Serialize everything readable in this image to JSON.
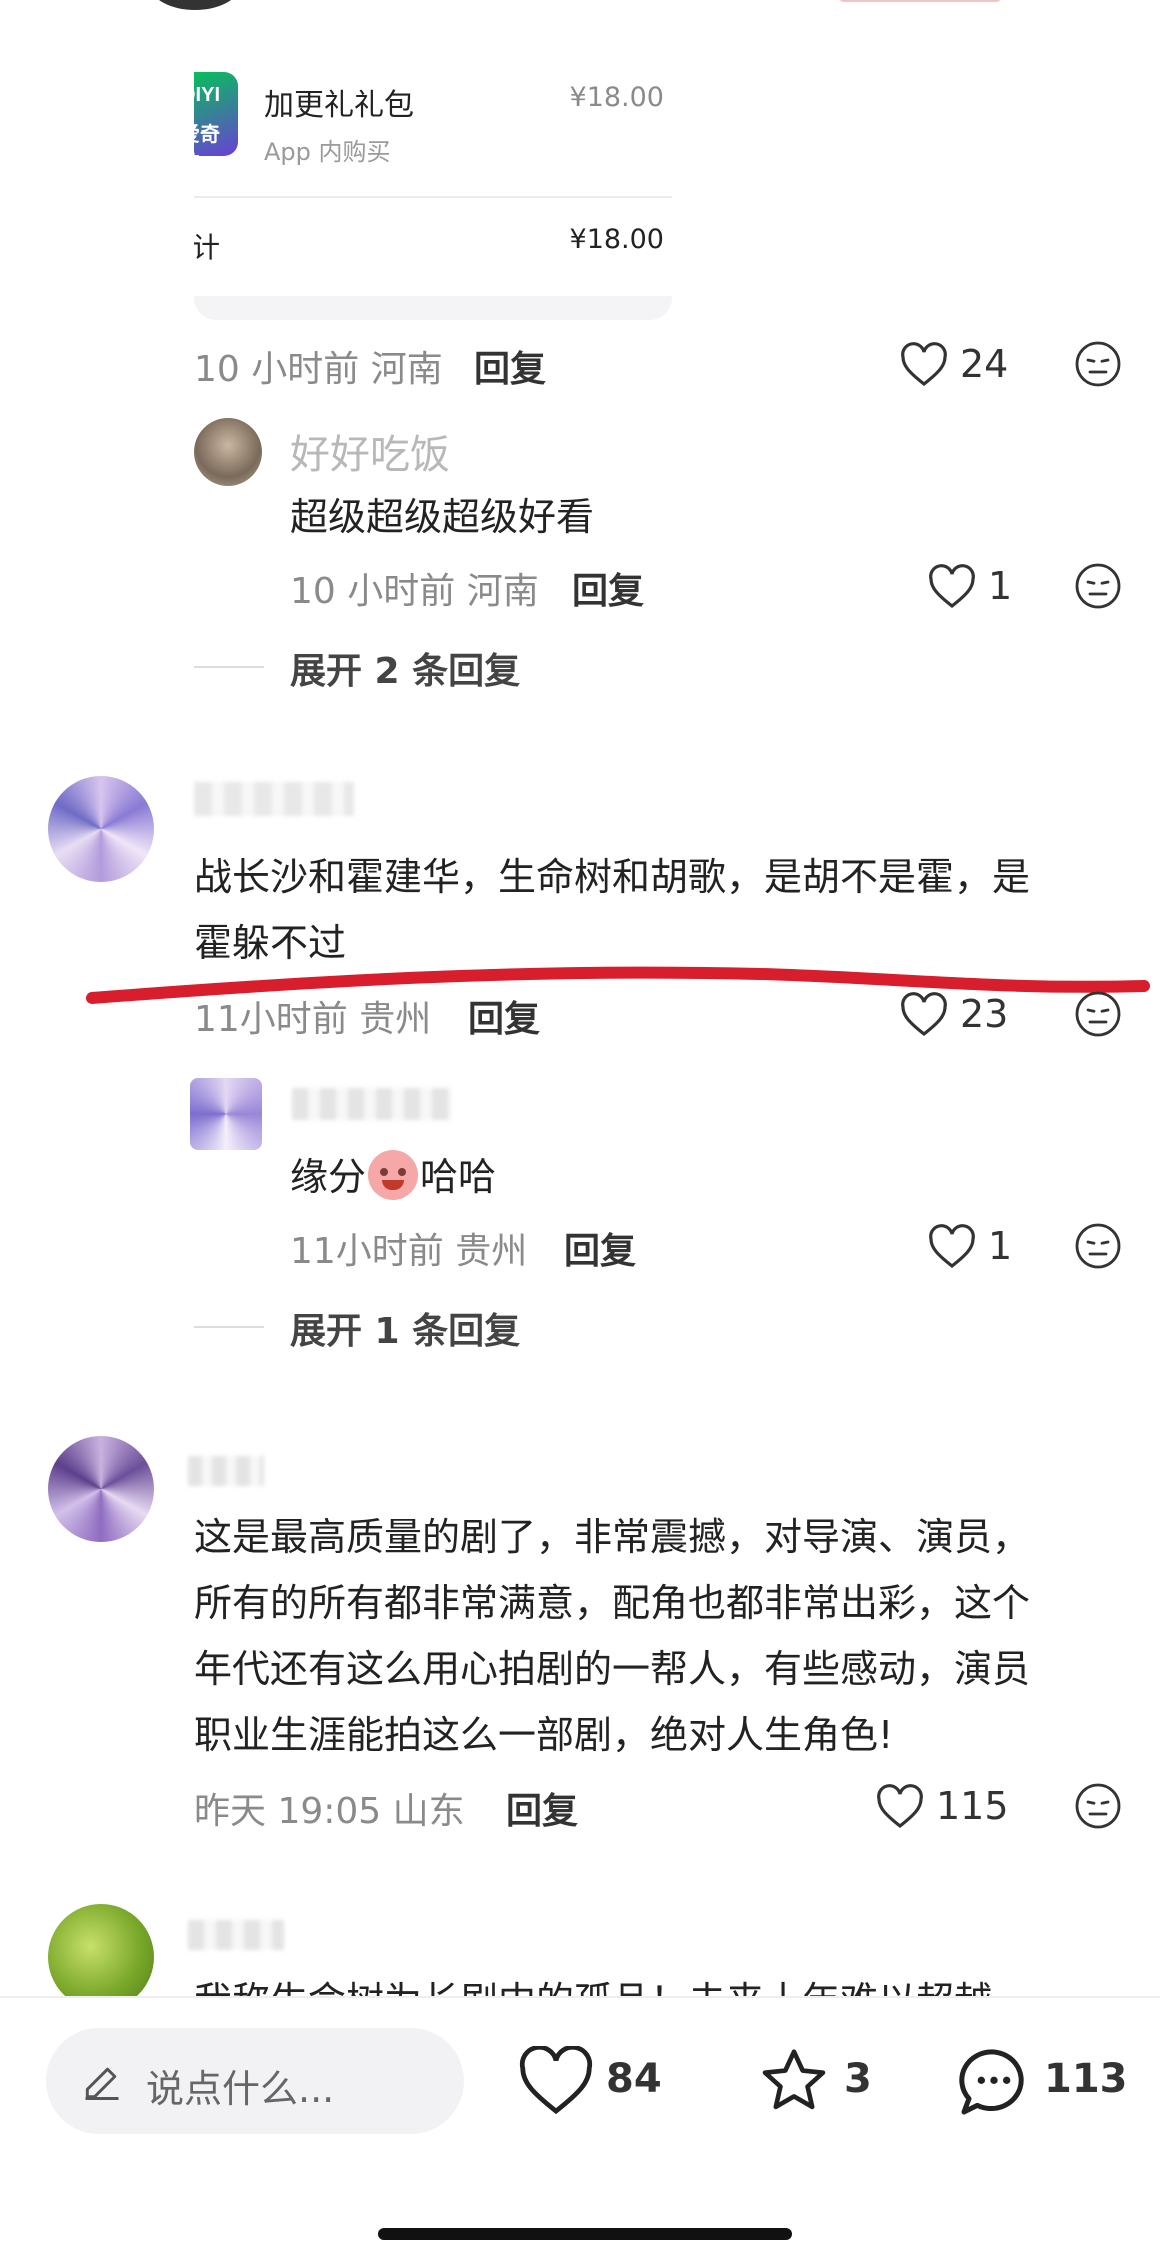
{
  "purchase_card": {
    "app_logo_text": [
      "QIYI",
      "爱奇艺"
    ],
    "item_name": "加更礼礼包",
    "item_price": "¥18.00",
    "item_type": "App 内购买",
    "total_label": "合计",
    "total_price": "¥18.00"
  },
  "comments": [
    {
      "meta": "10 小时前 河南",
      "reply_label": "回复",
      "likes": "24",
      "replies": [
        {
          "username": "好好吃饭",
          "text": "超级超级超级好看",
          "meta": "10 小时前 河南",
          "reply_label": "回复",
          "likes": "1"
        }
      ],
      "expand_label": "展开 2 条回复"
    },
    {
      "text_line1": "战长沙和霍建华，生命树和胡歌，是胡不是霍，是",
      "text_line2": "霍躲不过",
      "meta": "11小时前 贵州",
      "reply_label": "回复",
      "likes": "23",
      "replies": [
        {
          "text_a": "缘分",
          "text_b": "哈哈",
          "meta": "11小时前 贵州",
          "reply_label": "回复",
          "likes": "1"
        }
      ],
      "expand_label": "展开 1 条回复"
    },
    {
      "text_lines": [
        "这是最高质量的剧了，非常震撼，对导演、演员，",
        "所有的所有都非常满意，配角也都非常出彩，这个",
        "年代还有这么用心拍剧的一帮人，有些感动，演员",
        "职业生涯能拍这么一部剧，绝对人生角色!"
      ],
      "meta": "昨天 19:05 山东",
      "reply_label": "回复",
      "likes": "115"
    },
    {
      "text_partial": "我称生命树为长剧中的孤品！未来十年难以超越"
    }
  ],
  "bottom_bar": {
    "input_placeholder": "说点什么...",
    "likes": "84",
    "favorites": "3",
    "comments": "113"
  },
  "colors": {
    "accent_red": "#d81e2c",
    "meta_gray": "#8a8a8a",
    "iqiyi_green": "#00be06"
  }
}
